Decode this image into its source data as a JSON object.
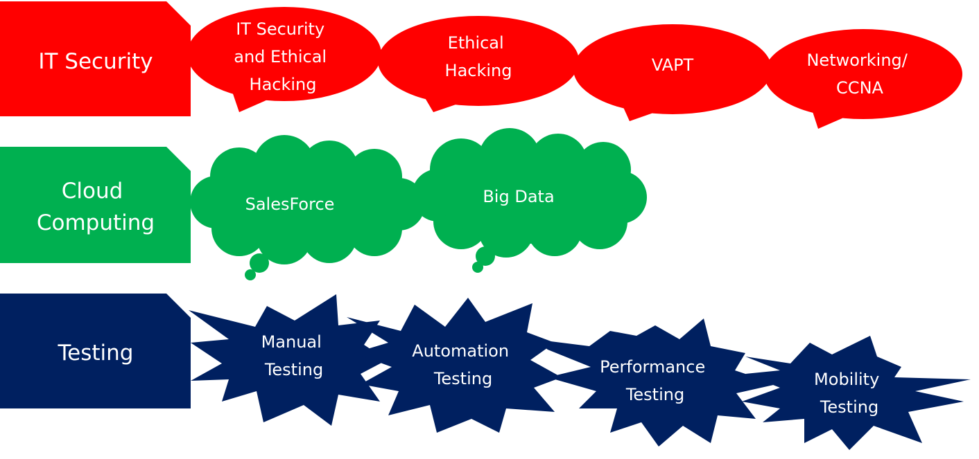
{
  "diagram": {
    "colors": {
      "security": "#ff0000",
      "cloud": "#00b050",
      "testing": "#002060",
      "text": "#ffffff"
    },
    "rows": [
      {
        "category": [
          "IT Security"
        ],
        "shape": "speech-bubble",
        "items": [
          [
            "IT Security",
            "and Ethical",
            "Hacking"
          ],
          [
            "Ethical",
            "Hacking"
          ],
          [
            "VAPT"
          ],
          [
            "Networking/",
            "CCNA"
          ]
        ]
      },
      {
        "category": [
          "Cloud",
          "Computing"
        ],
        "shape": "cloud",
        "items": [
          [
            "SalesForce"
          ],
          [
            "Big Data"
          ]
        ]
      },
      {
        "category": [
          "Testing"
        ],
        "shape": "starburst",
        "items": [
          [
            "Manual",
            "Testing"
          ],
          [
            "Automation",
            "Testing"
          ],
          [
            "Performance",
            "Testing"
          ],
          [
            "Mobility",
            "Testing"
          ]
        ]
      }
    ]
  }
}
